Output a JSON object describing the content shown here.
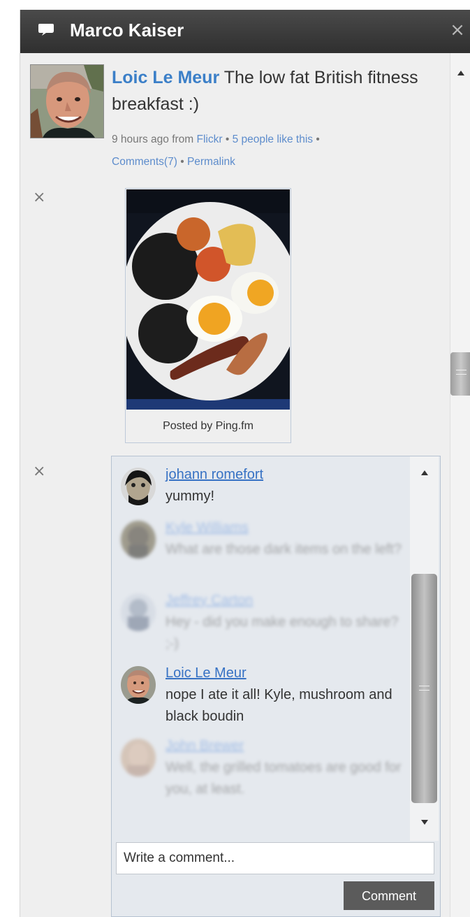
{
  "window": {
    "title": "Marco Kaiser",
    "close_glyph": "×",
    "title_icon": "speech-bubble-icon",
    "colors": {
      "titlebar": "#3a3a3a",
      "panel": "#efefef",
      "link": "#3b7fc8"
    }
  },
  "post": {
    "author": "Loic Le Meur",
    "text": "The low fat British fitness breakfast :)",
    "time": "9 hours ago",
    "from_label": "from",
    "source": "Flickr",
    "separator": " • ",
    "likes": "5 people like this",
    "comments_link": "Comments(7)",
    "permalink": "Permalink",
    "image_caption": "Posted by Ping.fm"
  },
  "dismiss_glyph": "×",
  "comments": [
    {
      "author": "johann romefort",
      "text": "yummy!"
    },
    {
      "author": "Kyle Williams",
      "text": "What are those dark items on the left?"
    },
    {
      "author": "Jeffrey Carton",
      "text": "Hey - did you make enough to share? ;-)"
    },
    {
      "author": "Loic Le Meur",
      "text": "nope I ate it all! Kyle, mushroom and black boudin"
    },
    {
      "author": "John Brewer",
      "text": "Well, the grilled tomatoes are good for you, at least."
    }
  ],
  "composer": {
    "placeholder": "Write a comment...",
    "button": "Comment"
  }
}
